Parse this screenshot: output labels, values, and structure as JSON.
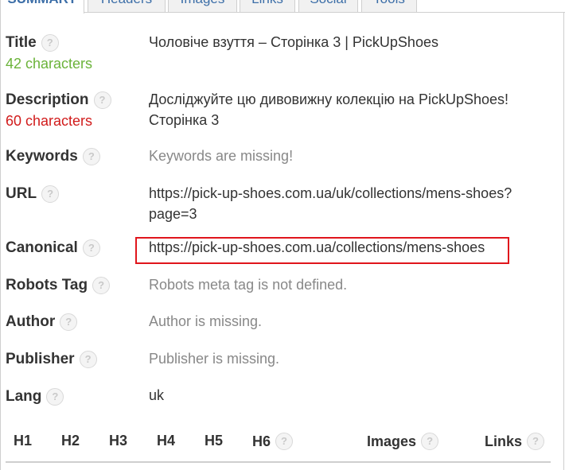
{
  "tabs": [
    "SUMMARY",
    "Headers",
    "Images",
    "Links",
    "Social",
    "Tools"
  ],
  "rows": {
    "title": {
      "label": "Title",
      "sub": "42 characters",
      "value": "Чоловіче взуття – Сторінка 3 | PickUpShoes"
    },
    "description": {
      "label": "Description",
      "sub": "60 characters",
      "value_line1": "Досліджуйте цю дивовижну колекцію на PickUpShoes!",
      "value_line2": "Сторінка 3"
    },
    "keywords": {
      "label": "Keywords",
      "value": "Keywords are missing!"
    },
    "url": {
      "label": "URL",
      "value_line1": "https://pick-up-shoes.com.ua/uk/collections/mens-shoes?",
      "value_line2": "page=3"
    },
    "canonical": {
      "label": "Canonical",
      "value": "https://pick-up-shoes.com.ua/collections/mens-shoes"
    },
    "robots": {
      "label": "Robots Tag",
      "value": "Robots meta tag is not defined."
    },
    "author": {
      "label": "Author",
      "value": "Author is missing."
    },
    "publisher": {
      "label": "Publisher",
      "value": "Publisher is missing."
    },
    "lang": {
      "label": "Lang",
      "value": "uk"
    }
  },
  "headers_row": [
    "H1",
    "H2",
    "H3",
    "H4",
    "H5",
    "H6",
    "Images",
    "Links"
  ],
  "help_glyph": "?",
  "colors": {
    "ok": "#6bb33a",
    "warn": "#d11b1b",
    "highlight": "#e0161c",
    "tab_text": "#3d6fa8"
  },
  "icons": {
    "help": "question-circle-icon"
  }
}
